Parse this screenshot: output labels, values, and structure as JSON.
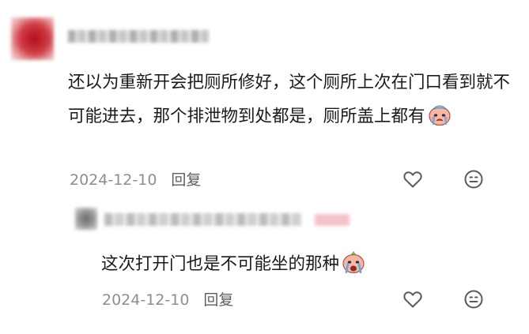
{
  "comments": [
    {
      "text": "还以为重新开会把厕所修好，这个厕所上次在门口看到就不可能进去，那个排泄物到处都是，厕所盖上都有",
      "date": "2024-12-10",
      "reply_label": "回复",
      "emoji": "crying-face-sticker"
    },
    {
      "text": "这次打开门也是不可能坐的那种",
      "date": "2024-12-10",
      "reply_label": "回复",
      "emoji": "crying-face-sticker"
    }
  ],
  "icons": {
    "like": "heart-outline-icon",
    "reaction": "smiley-face-icon"
  },
  "colors": {
    "text": "#1a1a1a",
    "meta": "#8e8e8e",
    "icon": "#5a5a5a"
  }
}
